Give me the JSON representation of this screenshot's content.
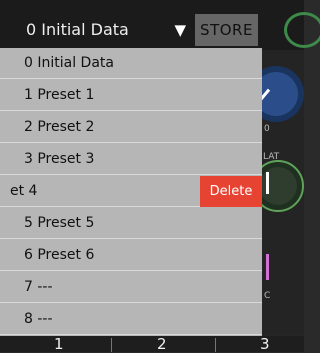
{
  "header": {
    "selected_preset": "0  Initial Data",
    "store_label": "STORE"
  },
  "dropdown": {
    "items": [
      {
        "label": "0  Initial Data"
      },
      {
        "label": "1  Preset 1"
      },
      {
        "label": "2  Preset 2"
      },
      {
        "label": "3  Preset 3"
      },
      {
        "label": "et 4",
        "swiped": true,
        "action": "Delete"
      },
      {
        "label": "5  Preset 5"
      },
      {
        "label": "6  Preset 6"
      },
      {
        "label": "7  ---"
      },
      {
        "label": "8  ---"
      }
    ]
  },
  "background": {
    "side_labels": {
      "zero": "0",
      "lat": "LAT",
      "c": "C"
    },
    "colors": {
      "delete": "#e74333",
      "knob_blue": "#2b4d8a",
      "knob_green": "#5fa35a",
      "accent_pink": "#d36fd6"
    }
  },
  "footer": {
    "tabs": [
      "1",
      "2",
      "3"
    ]
  }
}
